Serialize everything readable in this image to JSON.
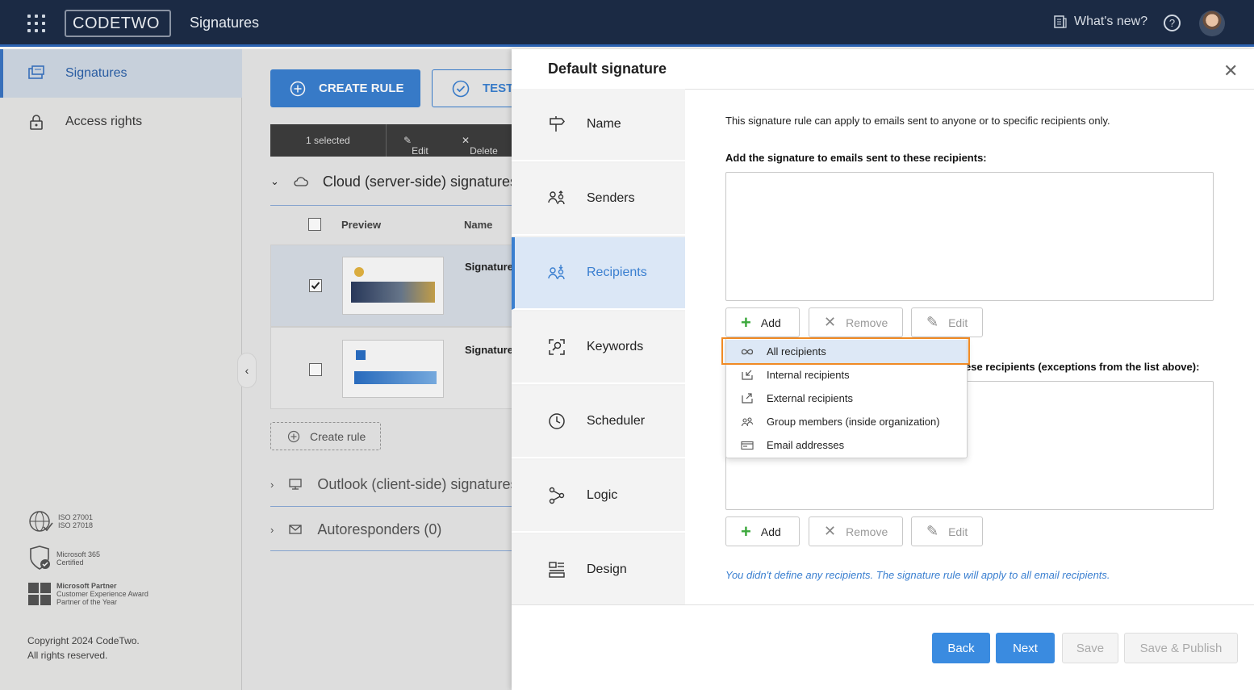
{
  "topbar": {
    "logo_text": "CODETWO",
    "app_title": "Signatures",
    "whats_new": "What's new?",
    "help": "?"
  },
  "sidebar": {
    "items": [
      {
        "label": "Signatures",
        "icon": "signatures-icon"
      },
      {
        "label": "Access rights",
        "icon": "lock-icon"
      }
    ],
    "badges": [
      {
        "line1": "ISO 27001",
        "line2": "ISO 27018",
        "line3": ""
      },
      {
        "line1": "Microsoft 365",
        "line2": "Certified",
        "line3": ""
      },
      {
        "line1": "Microsoft Partner",
        "line2": "Customer Experience Award",
        "line3": "Partner of the Year"
      }
    ],
    "copyright_1": "Copyright 2024 CodeTwo.",
    "copyright_2": "All rights reserved."
  },
  "main": {
    "create_rule": "CREATE RULE",
    "test": "TEST",
    "toolbar": {
      "selected": "1 selected",
      "edit": "Edit",
      "delete": "Delete"
    },
    "sections": {
      "cloud": "Cloud (server-side) signatures",
      "outlook": "Outlook (client-side) signatures",
      "autoresponders": "Autoresponders (0)"
    },
    "columns": {
      "preview": "Preview",
      "name": "Name"
    },
    "rows": [
      {
        "name": "Signature",
        "checked": true
      },
      {
        "name": "Signature",
        "checked": false
      }
    ],
    "create_rule_link": "Create rule"
  },
  "panel": {
    "title": "Default signature",
    "steps": [
      {
        "label": "Name",
        "icon": "signpost-icon"
      },
      {
        "label": "Senders",
        "icon": "senders-icon"
      },
      {
        "label": "Recipients",
        "icon": "recipients-icon",
        "active": true
      },
      {
        "label": "Keywords",
        "icon": "keywords-icon"
      },
      {
        "label": "Scheduler",
        "icon": "clock-icon"
      },
      {
        "label": "Logic",
        "icon": "logic-icon"
      },
      {
        "label": "Design",
        "icon": "design-icon"
      }
    ],
    "intro": "This signature rule can apply to emails sent to anyone or to specific recipients only.",
    "include_label": "Add the signature to emails sent to these recipients:",
    "exclude_label": "Do not add the signature to emails sent to these recipients (exceptions from the list above):",
    "exclude_label_visible": "ese recipients (exceptions from the list above):",
    "buttons": {
      "add": "Add",
      "remove": "Remove",
      "edit": "Edit"
    },
    "info": "You didn't define any recipients. The signature rule will apply to all email recipients.",
    "footer": {
      "back": "Back",
      "next": "Next",
      "save": "Save",
      "save_publish": "Save & Publish"
    }
  },
  "dropdown": {
    "items": [
      {
        "label": "All recipients",
        "icon": "infinity-icon",
        "highlighted": true
      },
      {
        "label": "Internal recipients",
        "icon": "internal-icon"
      },
      {
        "label": "External recipients",
        "icon": "external-icon"
      },
      {
        "label": "Group members (inside organization)",
        "icon": "group-icon"
      },
      {
        "label": "Email addresses",
        "icon": "email-card-icon"
      }
    ]
  },
  "colors": {
    "accent": "#3a7fd0",
    "topbar": "#1b2a44",
    "highlight_frame": "#f08a24",
    "add_plus": "#3ca83c"
  }
}
